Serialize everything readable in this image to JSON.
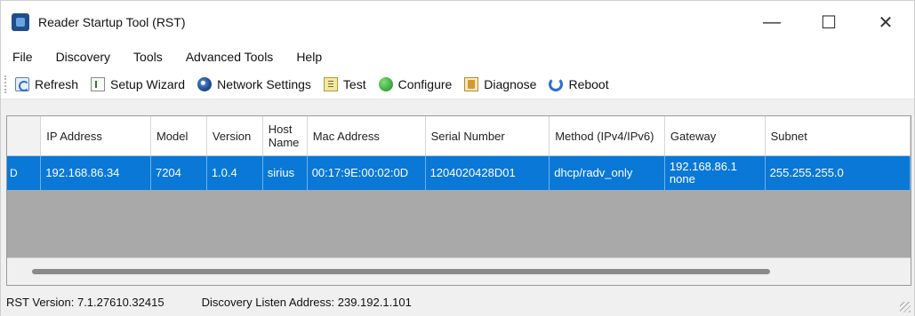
{
  "window": {
    "title": "Reader Startup Tool (RST)",
    "controls": {
      "minimize": "—",
      "maximize": "☐",
      "close": "✕"
    }
  },
  "menu": [
    "File",
    "Discovery",
    "Tools",
    "Advanced Tools",
    "Help"
  ],
  "toolbar": {
    "refresh": "Refresh",
    "setup_wizard": "Setup Wizard",
    "network_settings": "Network Settings",
    "test": "Test",
    "configure": "Configure",
    "diagnose": "Diagnose",
    "reboot": "Reboot"
  },
  "table": {
    "columns": [
      "",
      "IP Address",
      "Model",
      "Version",
      "Host Name",
      "Mac Address",
      "Serial Number",
      "Method (IPv4/IPv6)",
      "Gateway",
      "Subnet"
    ],
    "rows": [
      {
        "marker": "D",
        "ip": "192.168.86.34",
        "model": "7204",
        "version": "1.0.4",
        "host": "sirius",
        "mac": "00:17:9E:00:02:0D",
        "serial": "1204020428D01",
        "method": "dhcp/radv_only",
        "gateway": "192.168.86.1 none",
        "subnet": "255.255.255.0"
      }
    ]
  },
  "status": {
    "version": "RST Version: 7.1.27610.32415",
    "discovery": "Discovery Listen Address: 239.192.1.101"
  },
  "colors": {
    "selection": "#0a78d7",
    "grid_empty": "#a9a9a9"
  }
}
